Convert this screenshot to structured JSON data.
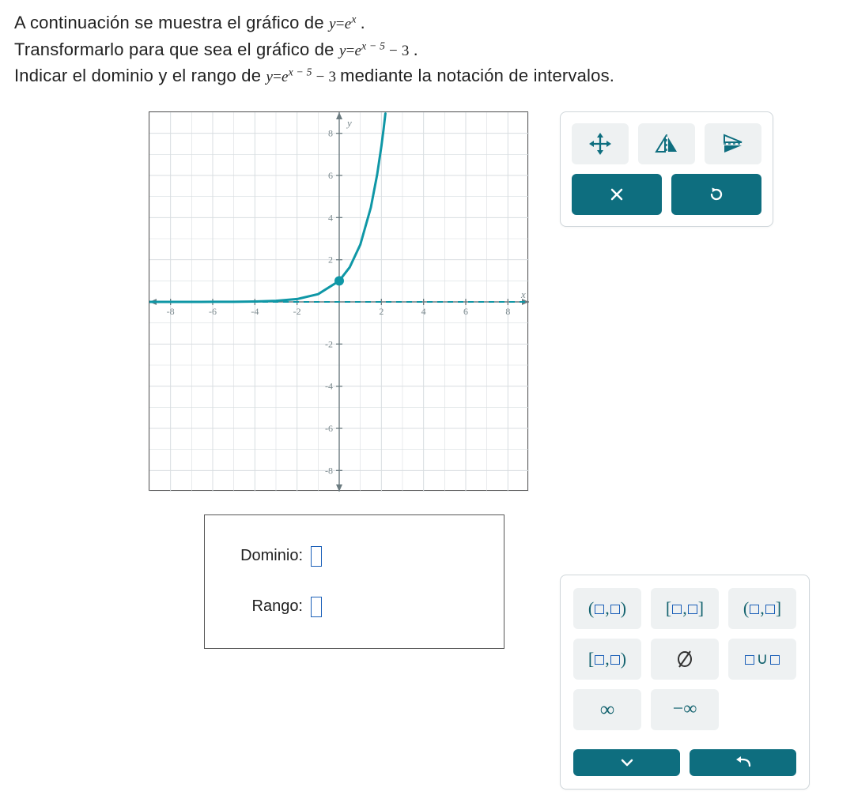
{
  "prompt": {
    "line1a": "A continuación se muestra el gráfico de ",
    "eq1_lhs": "y",
    "eq1_eq": "=",
    "eq1_rhs_base": "e",
    "eq1_rhs_sup": "x",
    "line1b": " .",
    "line2a": "Transformarlo para que sea el gráfico de ",
    "eq2_lhs": "y",
    "eq2_eq": "=",
    "eq2_base": "e",
    "eq2_sup": "x − 5",
    "eq2_tail": " − 3",
    "line2b": ".",
    "line3a": "Indicar el dominio y el rango de ",
    "eq3_lhs": "y",
    "eq3_eq": "=",
    "eq3_base": "e",
    "eq3_sup": "x − 5",
    "eq3_tail": " − 3",
    "line3b": " mediante la notación de intervalos."
  },
  "answers": {
    "domain_label": "Dominio:",
    "range_label": "Rango:"
  },
  "chart_data": {
    "type": "line",
    "title": "",
    "xlabel": "x",
    "ylabel": "y",
    "xlim": [
      -9,
      9
    ],
    "ylim": [
      -9,
      9
    ],
    "xticks": [
      -8,
      -6,
      -4,
      -2,
      2,
      4,
      6,
      8
    ],
    "yticks": [
      -8,
      -6,
      -4,
      -2,
      2,
      4,
      6,
      8
    ],
    "series": [
      {
        "name": "y = e^x",
        "color": "#0f97a6",
        "x": [
          -9,
          -8,
          -7,
          -6,
          -5,
          -4,
          -3,
          -2,
          -1,
          0,
          0.5,
          1,
          1.5,
          1.8,
          2,
          2.1,
          2.19
        ],
        "y": [
          0.000123,
          0.000335,
          0.000912,
          0.00248,
          0.00674,
          0.0183,
          0.0498,
          0.135,
          0.368,
          1,
          1.649,
          2.718,
          4.482,
          6.05,
          7.389,
          8.166,
          8.94
        ]
      }
    ],
    "asymptote": {
      "axis": "y",
      "value": 0,
      "style": "dashed",
      "color": "#0f97a6"
    },
    "marker_point": {
      "x": 0,
      "y": 1
    }
  },
  "interval_buttons": {
    "open_open": "(▫,▫)",
    "closed_closed": "[▫,▫]",
    "open_closed": "(▫,▫]",
    "closed_open": "[▫,▫)",
    "empty_set": "∅",
    "union": "▫∪▫",
    "infinity": "∞",
    "neg_infinity": "−∞"
  },
  "colors": {
    "accent_teal": "#0e6e7f",
    "curve": "#0f97a6",
    "grid": "#d8dde0",
    "axis": "#6b7b80",
    "input_border": "#1b5fb8"
  }
}
